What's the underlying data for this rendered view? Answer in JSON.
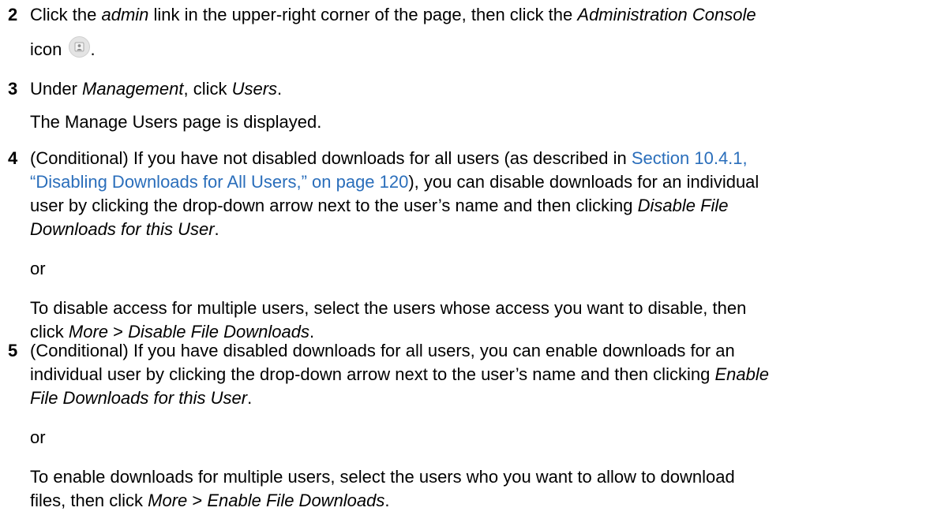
{
  "steps": [
    {
      "num": "2",
      "t1": "Click the ",
      "i1": "admin",
      "t2": " link in the upper-right corner of the page, then click the ",
      "i2": "Administration Console",
      "t3": "icon ",
      "t4": "."
    },
    {
      "num": "3",
      "t1": "Under ",
      "i1": "Management",
      "t2": ", click ",
      "i2": "Users",
      "t3": ".",
      "p2": "The Manage Users page is displayed."
    },
    {
      "num": "4",
      "t1": "(Conditional) If you have not disabled downloads for all users (as described in ",
      "link1": "Section 10.4.1,",
      "link2": "“Disabling Downloads for All Users,” on page 120",
      "t2": "), you can disable downloads for an individual",
      "t3": "user by clicking the drop-down arrow next to the user’s name and then clicking ",
      "i1": "Disable File",
      "i2": "Downloads for this User",
      "t4": ".",
      "or": "or",
      "p3a": "To disable access for multiple users, select the users whose access you want to disable, then",
      "p3b": "click ",
      "i3": "More",
      "gt": " > ",
      "i4": "Disable File Downloads",
      "end": "."
    },
    {
      "num": "5",
      "t1": "(Conditional) If you have disabled downloads for all users, you can enable downloads for an",
      "t2": "individual user by clicking the drop-down arrow next to the user’s name and then clicking ",
      "i1": "Enable",
      "i2": "File Downloads for this User",
      "t3": ".",
      "or": "or",
      "p3a": "To enable downloads for multiple users, select the users who you want to allow to download",
      "p3b": "files, then click ",
      "i3": "More",
      "gt": " > ",
      "i4": "Enable File Downloads",
      "end": "."
    }
  ],
  "icons": {
    "console_icon": "administration-console-icon"
  },
  "colors": {
    "link": "#2a6ebb",
    "text": "#000000"
  }
}
